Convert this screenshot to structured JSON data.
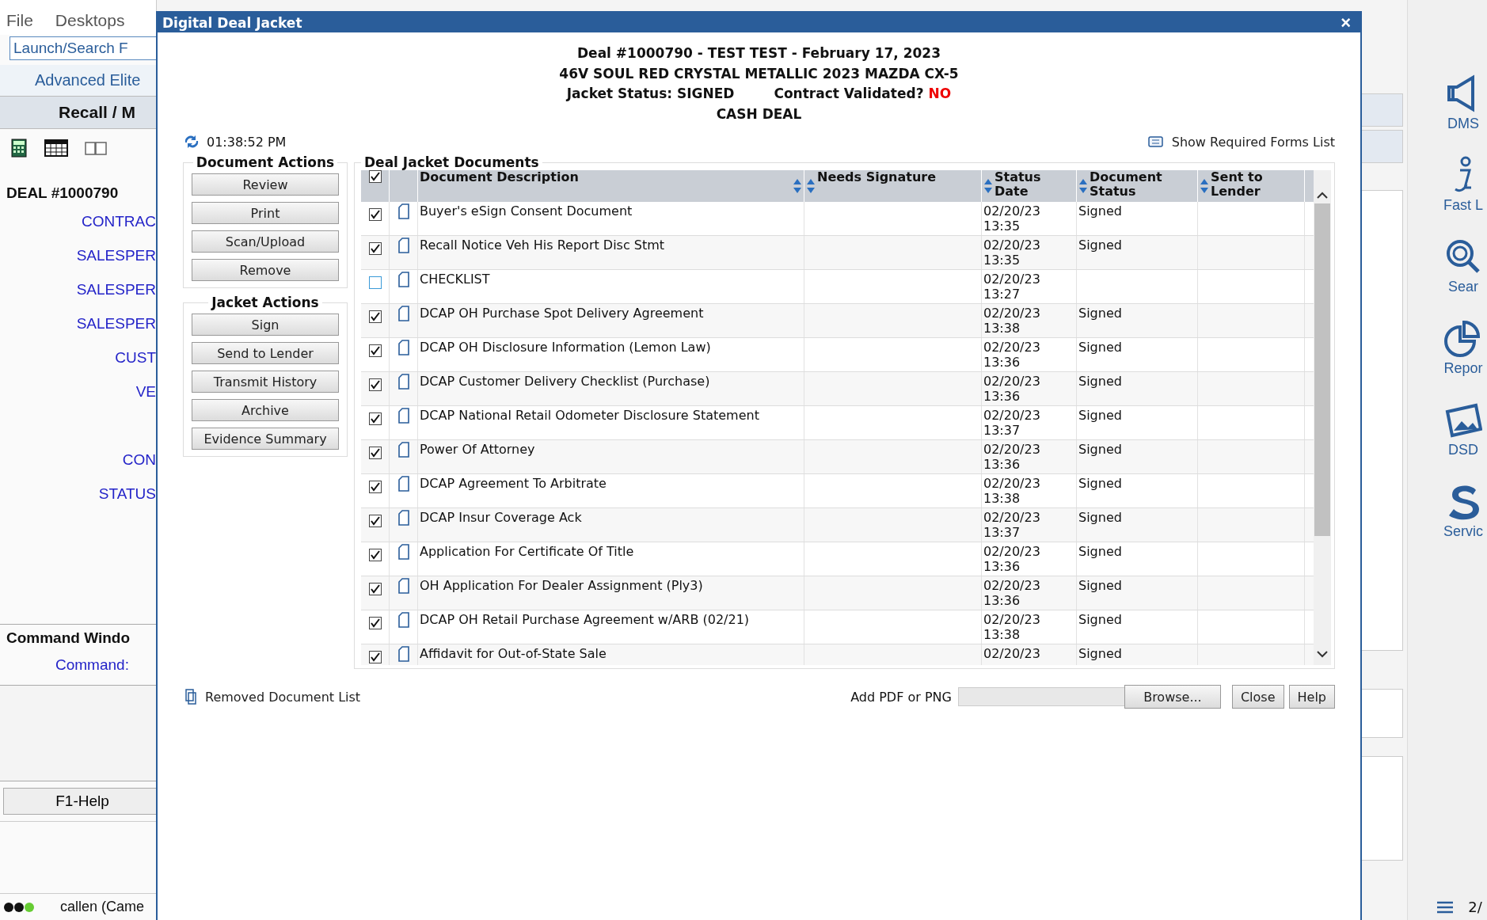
{
  "app": {
    "menu": [
      "File",
      "Desktops"
    ],
    "launch_field": {
      "value": "Launch/Search F"
    },
    "advanced": "Advanced Elite",
    "header": "Recall / M",
    "deal_label": "DEAL #1000790",
    "fields": [
      "CONTRAC",
      "SALESPER",
      "SALESPER",
      "SALESPER",
      "CUST",
      "VE",
      "CON",
      "STATUS"
    ],
    "command_window": {
      "title": "Command Windo",
      "label": "Command:"
    },
    "help_button": "F1-Help",
    "status_user": "callen (Came"
  },
  "right_bar": {
    "items": [
      {
        "kind": "megaphone",
        "label": "DMS"
      },
      {
        "kind": "info",
        "label": "Fast L"
      },
      {
        "kind": "search",
        "label": "Sear"
      },
      {
        "kind": "chart",
        "label": "Repor"
      },
      {
        "kind": "photo",
        "label": "DSD"
      },
      {
        "kind": "s-logo",
        "label": "Servic"
      }
    ],
    "page": "2/"
  },
  "dialog": {
    "title": "Digital Deal Jacket",
    "close": "×",
    "heading": {
      "deal": "Deal #1000790 - TEST TEST - February 17, 2023",
      "vehicle": "46V SOUL RED CRYSTAL METALLIC 2023 MAZDA CX-5",
      "jacket_status": "Jacket Status: SIGNED",
      "contract_label": "Contract Validated?",
      "contract_value": "NO",
      "deal_type": "CASH DEAL"
    },
    "time": "01:38:52 PM",
    "required_forms_link": "Show Required Forms List",
    "document_actions": {
      "title": "Document Actions",
      "buttons": [
        "Review",
        "Print",
        "Scan/Upload",
        "Remove"
      ]
    },
    "jacket_actions": {
      "title": "Jacket Actions",
      "buttons": [
        "Sign",
        "Send to Lender",
        "Transmit History",
        "Archive",
        "Evidence Summary"
      ]
    },
    "documents": {
      "title": "Deal Jacket Documents",
      "all_checked": true,
      "columns": [
        {
          "label": "Document Description"
        },
        {
          "label": "Needs Signature"
        },
        {
          "label": "Status Date"
        },
        {
          "label": "Document Status"
        },
        {
          "label": "Sent to Lender"
        }
      ],
      "rows": [
        {
          "checked": true,
          "description": "Buyer's eSign Consent Document",
          "date": "02/20/23",
          "time": "13:35",
          "status": "Signed"
        },
        {
          "checked": true,
          "description": "Recall Notice Veh His Report Disc Stmt",
          "date": "02/20/23",
          "time": "13:35",
          "status": "Signed"
        },
        {
          "checked": false,
          "description": "CHECKLIST",
          "date": "02/20/23",
          "time": "13:27"
        },
        {
          "checked": true,
          "description": "DCAP OH Purchase Spot Delivery Agreement",
          "date": "02/20/23",
          "time": "13:38",
          "status": "Signed"
        },
        {
          "checked": true,
          "description": "DCAP OH Disclosure Information (Lemon Law)",
          "date": "02/20/23",
          "time": "13:36",
          "status": "Signed"
        },
        {
          "checked": true,
          "description": "DCAP Customer Delivery Checklist (Purchase)",
          "date": "02/20/23",
          "time": "13:36",
          "status": "Signed"
        },
        {
          "checked": true,
          "description": "DCAP National Retail Odometer Disclosure Statement",
          "date": "02/20/23",
          "time": "13:37",
          "status": "Signed"
        },
        {
          "checked": true,
          "description": "Power Of Attorney",
          "date": "02/20/23",
          "time": "13:36",
          "status": "Signed"
        },
        {
          "checked": true,
          "description": "DCAP Agreement To Arbitrate",
          "date": "02/20/23",
          "time": "13:38",
          "status": "Signed"
        },
        {
          "checked": true,
          "description": "DCAP Insur Coverage Ack",
          "date": "02/20/23",
          "time": "13:37",
          "status": "Signed"
        },
        {
          "checked": true,
          "description": "Application For Certificate Of Title",
          "date": "02/20/23",
          "time": "13:36",
          "status": "Signed"
        },
        {
          "checked": true,
          "description": "OH Application For Dealer Assignment (Ply3)",
          "date": "02/20/23",
          "time": "13:36",
          "status": "Signed"
        },
        {
          "checked": true,
          "description": "DCAP OH Retail Purchase Agreement w/ARB (02/21)",
          "date": "02/20/23",
          "time": "13:38",
          "status": "Signed"
        },
        {
          "checked": true,
          "description": "Affidavit for Out-of-State Sale",
          "date": "02/20/23",
          "status": "Signed"
        }
      ]
    },
    "removed_link": "Removed Document List",
    "upload_label": "Add PDF or PNG",
    "browse_button": "Browse...",
    "footer_buttons": [
      "Close",
      "Help"
    ]
  }
}
